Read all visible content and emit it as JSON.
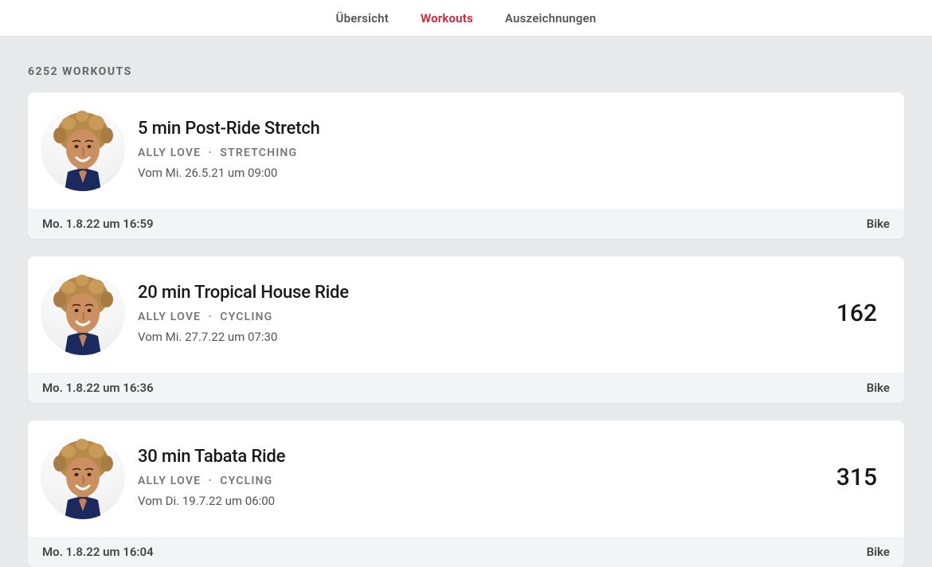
{
  "nav": {
    "overview": "Übersicht",
    "workouts": "Workouts",
    "awards": "Auszeichnungen"
  },
  "section_header": "6252 WORKOUTS",
  "workouts": [
    {
      "title": "5 min Post-Ride Stretch",
      "instructor": "ALLY LOVE",
      "dot": "·",
      "category": "STRETCHING",
      "subtext": "Vom Mi. 26.5.21 um 09:00",
      "metric": "",
      "footer_date": "Mo. 1.8.22 um 16:59",
      "footer_device": "Bike"
    },
    {
      "title": "20 min Tropical House Ride",
      "instructor": "ALLY LOVE",
      "dot": "·",
      "category": "CYCLING",
      "subtext": "Vom Mi. 27.7.22 um 07:30",
      "metric": "162",
      "footer_date": "Mo. 1.8.22 um 16:36",
      "footer_device": "Bike"
    },
    {
      "title": "30 min Tabata Ride",
      "instructor": "ALLY LOVE",
      "dot": "·",
      "category": "CYCLING",
      "subtext": "Vom Di. 19.7.22 um 06:00",
      "metric": "315",
      "footer_date": "Mo. 1.8.22 um 16:04",
      "footer_device": "Bike"
    }
  ]
}
